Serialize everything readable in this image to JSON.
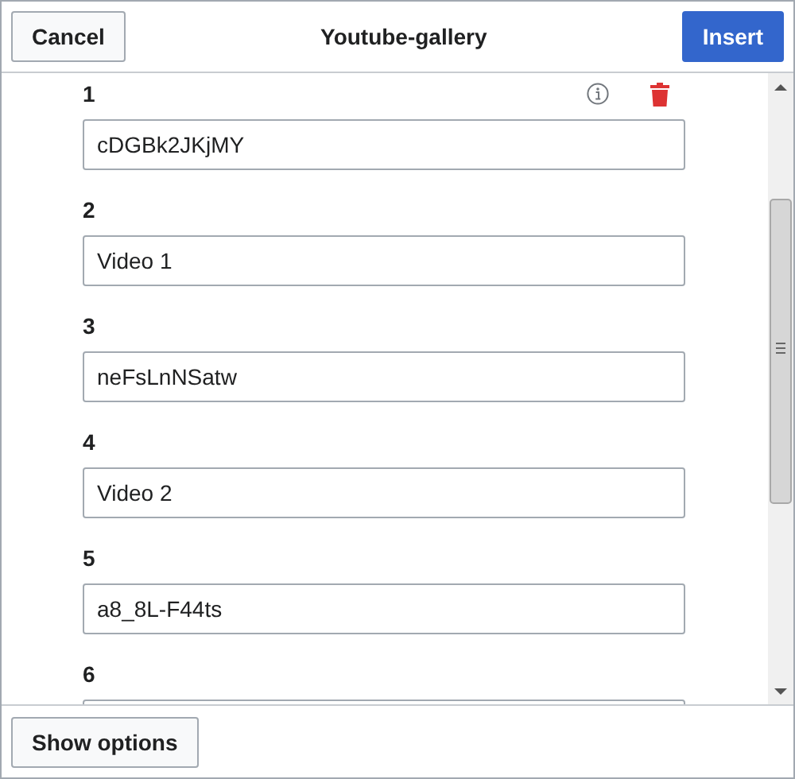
{
  "header": {
    "cancel": "Cancel",
    "title": "Youtube-gallery",
    "insert": "Insert"
  },
  "items": [
    {
      "label": "1",
      "value": "cDGBk2JKjMY",
      "tools": true
    },
    {
      "label": "2",
      "value": "Video 1",
      "tools": false
    },
    {
      "label": "3",
      "value": "neFsLnNSatw",
      "tools": false
    },
    {
      "label": "4",
      "value": "Video 2",
      "tools": false
    },
    {
      "label": "5",
      "value": "a8_8L-F44ts",
      "tools": false
    },
    {
      "label": "6",
      "tools": false
    }
  ],
  "footer": {
    "button": "Show options"
  }
}
